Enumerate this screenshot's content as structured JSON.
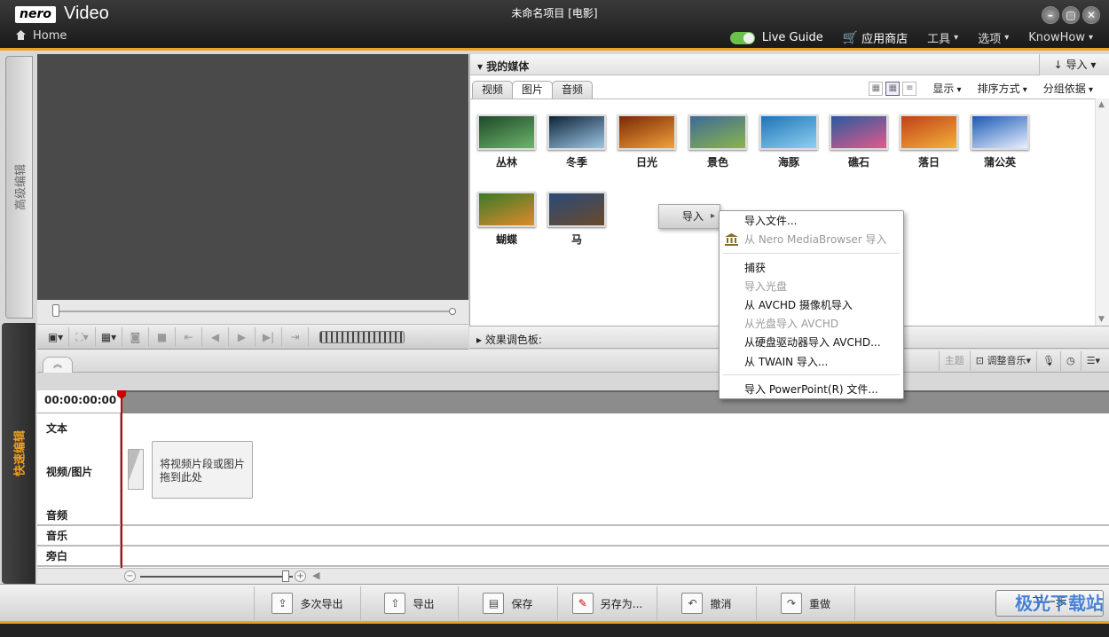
{
  "window": {
    "logo": "nero",
    "app_name": "Video",
    "home": "Home",
    "project_title": "未命名项目 [电影]",
    "controls": [
      "–",
      "▢",
      "✕"
    ]
  },
  "top_menu": {
    "live_guide": "Live Guide",
    "app_store": "应用商店",
    "tools": "工具",
    "options": "选项",
    "knowhow": "KnowHow"
  },
  "side_tabs": {
    "advanced": "高级编辑",
    "quick": "快速编辑"
  },
  "media": {
    "title": "我的媒体",
    "import_label": "导入",
    "tabs": [
      {
        "label": "视频",
        "active": false
      },
      {
        "label": "图片",
        "active": true
      },
      {
        "label": "音频",
        "active": false
      }
    ],
    "display": "显示",
    "sort": "排序方式",
    "group": "分组依据",
    "items": [
      {
        "label": "丛林",
        "colors": [
          "#1d4a2a",
          "#6fb46a"
        ]
      },
      {
        "label": "冬季",
        "colors": [
          "#0d2438",
          "#9fc6e6"
        ]
      },
      {
        "label": "日光",
        "colors": [
          "#7a2a05",
          "#f3a03a"
        ]
      },
      {
        "label": "景色",
        "colors": [
          "#3d6a9a",
          "#8bb44a"
        ]
      },
      {
        "label": "海豚",
        "colors": [
          "#1e74b8",
          "#8fd0f0"
        ]
      },
      {
        "label": "礁石",
        "colors": [
          "#2a5aa0",
          "#e25a8a"
        ]
      },
      {
        "label": "落日",
        "colors": [
          "#c2401a",
          "#f2b23a"
        ]
      },
      {
        "label": "蒲公英",
        "colors": [
          "#1b5ab4",
          "#e8f0ff"
        ]
      },
      {
        "label": "蝴蝶",
        "colors": [
          "#3a7a2a",
          "#e08a2a"
        ]
      },
      {
        "label": "马",
        "colors": [
          "#2a4a7a",
          "#6a4a2a"
        ]
      }
    ]
  },
  "effects": {
    "title": "效果调色板:"
  },
  "timeline_tools": {
    "theme": "主题",
    "adjust_music": "调整音乐"
  },
  "timeline": {
    "timecode": "00:00:00:00",
    "tracks": {
      "text": "文本",
      "video": "视频/图片",
      "audio": "音频",
      "music": "音乐",
      "narration": "旁白"
    },
    "drop_hint": "将视频片段或图片拖到此处"
  },
  "bottom_bar": {
    "multi_export": "多次导出",
    "export": "导出",
    "save": "保存",
    "save_as": "另存为...",
    "undo": "撤消",
    "redo": "重做",
    "next": "下一步"
  },
  "watermark": "极光下载站",
  "context_menu": {
    "import": "导入",
    "items": [
      {
        "label": "导入文件...",
        "disabled": false
      },
      {
        "label": "从 Nero MediaBrowser 导入",
        "disabled": true
      },
      {
        "label": "捕获",
        "disabled": false
      },
      {
        "label": "导入光盘",
        "disabled": true
      },
      {
        "label": "从 AVCHD 摄像机导入",
        "disabled": false
      },
      {
        "label": "从光盘导入 AVCHD",
        "disabled": true
      },
      {
        "label": "从硬盘驱动器导入 AVCHD...",
        "disabled": false
      },
      {
        "label": "从 TWAIN 导入...",
        "disabled": false
      },
      {
        "label": "导入 PowerPoint(R) 文件...",
        "disabled": false
      }
    ]
  }
}
